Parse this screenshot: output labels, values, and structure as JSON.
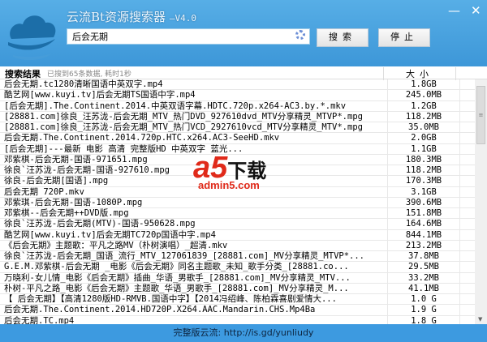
{
  "app": {
    "title": "云流Bt资源搜索器",
    "version": "—V4.0",
    "minimize": "—",
    "close": "✕"
  },
  "search": {
    "value": "后会无期",
    "search_label": "搜索",
    "stop_label": "停止"
  },
  "header": {
    "title": "搜索结果",
    "status": "已搜到65条数据, 耗时1秒",
    "size_col": "大小"
  },
  "rows": [
    {
      "name": "后会无期.tc1280清晰国语中英双字.mp4",
      "size": "1.8GB"
    },
    {
      "name": "酷艺网[www.kuyi.tv]后会无期TS国语中字.mp4",
      "size": "245.0MB"
    },
    {
      "name": "[后会无期].The.Continent.2014.中英双语字幕.HDTC.720p.x264-AC3.by.*.mkv",
      "size": "1.2GB"
    },
    {
      "name": "[28881.com]徐良_汪苏泷-后会无期_MTV_热门DVD_927610dvd_MTV分享精灵_MTVP*.mpg",
      "size": "118.2MB"
    },
    {
      "name": "[28881.com]徐良_汪苏泷-后会无期_MTV_热门VCD_2927610vcd_MTV分享精灵_MTV*.mpg",
      "size": "35.0MB"
    },
    {
      "name": "后会无期.The.Continent.2014.720p.HTC.x264.AC3-SeeHD.mkv",
      "size": "2.0GB"
    },
    {
      "name": "[后会无期]---最新 电影 高清 完整版HD      中英双字 蓝光...",
      "size": "1.1GB"
    },
    {
      "name": "邓紫棋-后会无期-国语-971651.mpg",
      "size": "180.3MB"
    },
    {
      "name": "徐良`汪苏泷-后会无期-国语-927610.mpg",
      "size": "118.2MB"
    },
    {
      "name": "徐良-后会无期[国语].mpg",
      "size": "170.3MB"
    },
    {
      "name": "后会无期 720P.mkv",
      "size": "3.1GB"
    },
    {
      "name": "邓紫琪-后会无期-国语-1080P.mpg",
      "size": "390.6MB"
    },
    {
      "name": "邓紫棋--后会无期++DVD版.mpg",
      "size": "151.8MB"
    },
    {
      "name": "徐良`汪苏泷-后会无期(MTV)-国语-950628.mpg",
      "size": "164.6MB"
    },
    {
      "name": "酷艺网[www.kuyi.tv]后会无期TC720p国语中字.mp4",
      "size": "844.1MB"
    },
    {
      "name": "《后会无期》主题歌：平凡之路MV（朴树演唱）_超清.mkv",
      "size": "213.2MB"
    },
    {
      "name": "徐良`汪苏泷-后会无期_国语_流行_MTV_127061839_[28881.com]_MV分享精灵_MTVP*...",
      "size": "37.8MB"
    },
    {
      "name": "G.E.M.邓紫棋-后会无期 _电影《后会无期》同名主题歌_未知_歌手分类_[28881.co...",
      "size": "29.5MB"
    },
    {
      "name": "万晓利-女儿情_电影《后会无期》插曲_华语_男歌手_[28881.com]_MV分享精灵_MTV...",
      "size": "33.2MB"
    },
    {
      "name": "朴树-平凡之路_电影《后会无期》主题歌_华语_男歌手_[28881.com]_MV分享精灵_M...",
      "size": "41.1MB"
    },
    {
      "name": "【 后会无期】【高清1280版HD-RMVB.国语中字】【2014冯绍峰、陈柏霖喜剧爱情大...",
      "size": "1.0 G"
    },
    {
      "name": " 后会无期.The.Continent.2014.HD720P.X264.AAC.Mandarin.CHS.Mp4Ba",
      "size": "1.9 G"
    },
    {
      "name": " 后会无期.TC.mp4",
      "size": "1.8 G"
    }
  ],
  "footer": {
    "text": "完整版云流: http://is.gd/yunliudy"
  },
  "watermark": {
    "logo": "a5",
    "text": "下载",
    "site": "admin5.com"
  }
}
